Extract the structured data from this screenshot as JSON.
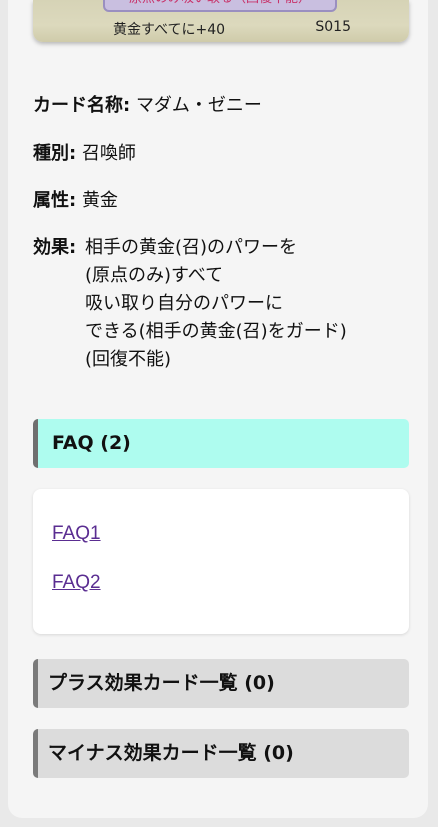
{
  "card_image": {
    "banner_text": "原点のみ吸い取る（回復不能）",
    "effect_text": "黄金すべてに+40",
    "code": "S015"
  },
  "card_info": {
    "name_label": "カード名称:",
    "name_value": "マダム・ゼニー",
    "type_label": "種別:",
    "type_value": "召喚師",
    "attribute_label": "属性:",
    "attribute_value": "黄金",
    "effect_label": "効果:",
    "effect_lines": [
      "相手の黄金(召)のパワーを",
      "(原点のみ)すべて",
      "吸い取り自分のパワーに",
      "できる(相手の黄金(召)をガード)",
      "(回復不能)"
    ]
  },
  "faq": {
    "header": "FAQ (2)",
    "links": [
      "FAQ1",
      "FAQ2"
    ]
  },
  "plus_section": {
    "header": "プラス効果カード一覧 (0)"
  },
  "minus_section": {
    "header": "マイナス効果カード一覧 (0)"
  },
  "colors": {
    "faq_header_bg": "#aefcef",
    "link": "#5a2d91",
    "section_bg": "#dcdcdc"
  }
}
